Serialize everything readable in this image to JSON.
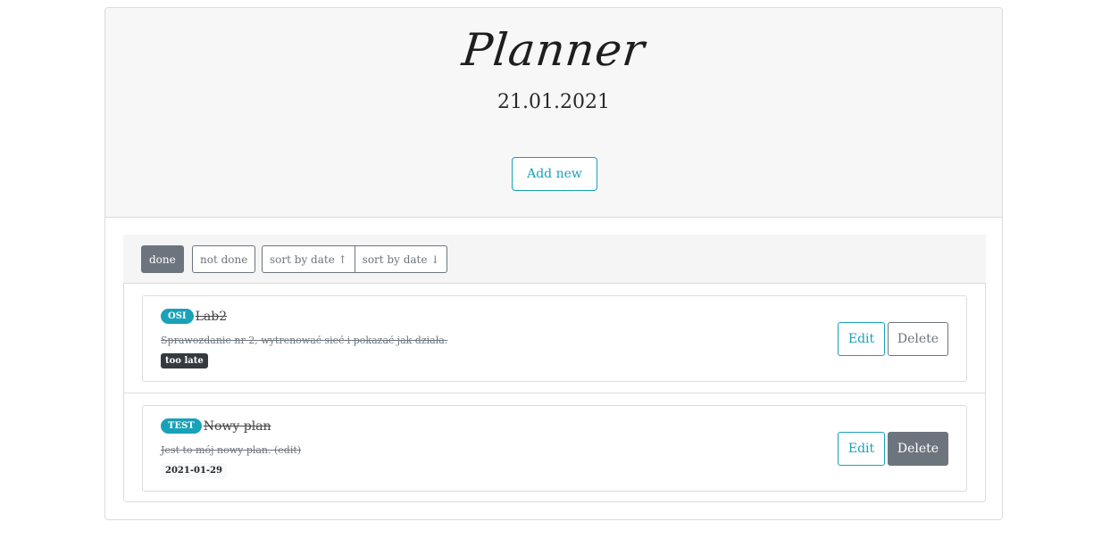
{
  "header": {
    "title": "Planner",
    "date": "21.01.2021",
    "add_label": "Add new"
  },
  "filters": {
    "done_label": "done",
    "not_done_label": "not done",
    "sort_asc_label": "sort by date ↑",
    "sort_desc_label": "sort by date ↓",
    "active": "done"
  },
  "tasks": [
    {
      "tag": "OSI",
      "title": "Lab2",
      "description": "Sprawozdanie nr 2, wytrenować sieć i pokazać jak działa.",
      "status": "too late",
      "edit_label": "Edit",
      "delete_label": "Delete"
    },
    {
      "tag": "TEST",
      "title": "Nowy plan",
      "description": "Jest to mój nowy plan. (edit)",
      "status": "2021-01-29",
      "edit_label": "Edit",
      "delete_label": "Delete"
    }
  ],
  "colors": {
    "accent": "#17a2b8",
    "secondary": "#6c757d",
    "dark": "#343a40"
  }
}
